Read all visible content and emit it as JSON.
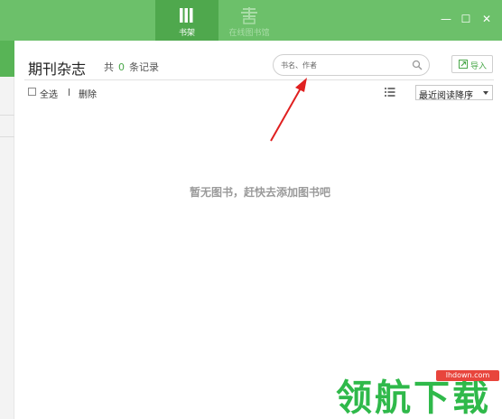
{
  "tabs": [
    {
      "label": "书架",
      "icon": "bookshelf-icon",
      "active": true
    },
    {
      "label": "在线图书馆",
      "icon": "online-library-icon",
      "active": false
    }
  ],
  "window_controls": {
    "minimize": "—",
    "maximize": "☐",
    "close": "✕"
  },
  "header": {
    "title": "期刊杂志",
    "count_prefix": "共",
    "count_value": "0",
    "count_suffix": "条记录"
  },
  "search": {
    "placeholder": "书名、作者",
    "icon": "search-icon"
  },
  "import_button": {
    "label": "导入",
    "icon": "import-icon"
  },
  "toolbar": {
    "select_all_label": "全选",
    "delete_label": "删除",
    "view_icon": "list-view-icon",
    "sort_selected": "最近阅读降序"
  },
  "empty_message": "暂无图书，赶快去添加图书吧",
  "watermark": {
    "text": "领航下载",
    "url": "lhdown.com"
  },
  "colors": {
    "topbar": "#6cc06a",
    "active_tab": "#4fa84d",
    "accent": "#4aa84a",
    "arrow": "#e02020",
    "watermark": "#2fb94a"
  }
}
